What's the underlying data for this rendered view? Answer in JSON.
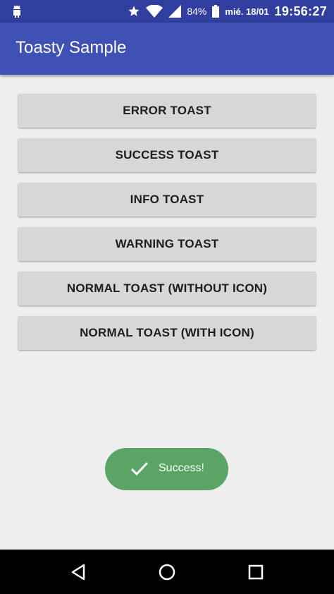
{
  "status_bar": {
    "battery_percent": "84%",
    "date": "mié. 18/01",
    "time": "19:56:27",
    "icons": [
      "android-icon",
      "star-icon",
      "wifi-icon",
      "signal-icon",
      "battery-icon"
    ]
  },
  "app_bar": {
    "title": "Toasty Sample",
    "color": "#3f51b5"
  },
  "buttons": [
    {
      "label": "ERROR TOAST"
    },
    {
      "label": "SUCCESS TOAST"
    },
    {
      "label": "INFO TOAST"
    },
    {
      "label": "WARNING TOAST"
    },
    {
      "label": "NORMAL TOAST (WITHOUT ICON)"
    },
    {
      "label": "NORMAL TOAST (WITH ICON)"
    }
  ],
  "toast": {
    "text": "Success!",
    "icon": "check-icon",
    "color": "#5aa466"
  },
  "nav_bar": {
    "icons": [
      "back-icon",
      "home-icon",
      "recents-icon"
    ]
  }
}
